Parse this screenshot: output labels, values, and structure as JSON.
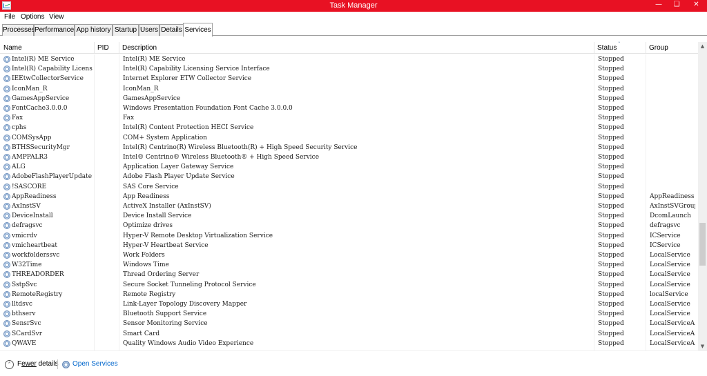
{
  "window": {
    "title": "Task Manager",
    "min_glyph": "—",
    "max_glyph": "❏",
    "close_glyph": "✕"
  },
  "menu": [
    "File",
    "Options",
    "View"
  ],
  "tabs": [
    "Processes",
    "Performance",
    "App history",
    "Startup",
    "Users",
    "Details",
    "Services"
  ],
  "active_tab": "Services",
  "columns": {
    "name": "Name",
    "pid": "PID",
    "description": "Description",
    "status": "Status",
    "group": "Group"
  },
  "sort_indicator": "˄",
  "rows": [
    {
      "name": "Intel(R) ME Service",
      "pid": "",
      "description": "Intel(R) ME Service",
      "status": "Stopped",
      "group": ""
    },
    {
      "name": "Intel(R) Capability Licensin...",
      "pid": "",
      "description": "Intel(R) Capability Licensing Service Interface",
      "status": "Stopped",
      "group": ""
    },
    {
      "name": "IEEtwCollectorService",
      "pid": "",
      "description": "Internet Explorer ETW Collector Service",
      "status": "Stopped",
      "group": ""
    },
    {
      "name": "IconMan_R",
      "pid": "",
      "description": "IconMan_R",
      "status": "Stopped",
      "group": ""
    },
    {
      "name": "GamesAppService",
      "pid": "",
      "description": "GamesAppService",
      "status": "Stopped",
      "group": ""
    },
    {
      "name": "FontCache3.0.0.0",
      "pid": "",
      "description": "Windows Presentation Foundation Font Cache 3.0.0.0",
      "status": "Stopped",
      "group": ""
    },
    {
      "name": "Fax",
      "pid": "",
      "description": "Fax",
      "status": "Stopped",
      "group": ""
    },
    {
      "name": "cphs",
      "pid": "",
      "description": "Intel(R) Content Protection HECI Service",
      "status": "Stopped",
      "group": ""
    },
    {
      "name": "COMSysApp",
      "pid": "",
      "description": "COM+ System Application",
      "status": "Stopped",
      "group": ""
    },
    {
      "name": "BTHSSecurityMgr",
      "pid": "",
      "description": "Intel(R) Centrino(R) Wireless Bluetooth(R) + High Speed Security Service",
      "status": "Stopped",
      "group": ""
    },
    {
      "name": "AMPPALR3",
      "pid": "",
      "description": "Intel® Centrino® Wireless Bluetooth® + High Speed Service",
      "status": "Stopped",
      "group": ""
    },
    {
      "name": "ALG",
      "pid": "",
      "description": "Application Layer Gateway Service",
      "status": "Stopped",
      "group": ""
    },
    {
      "name": "AdobeFlashPlayerUpdateSvc",
      "pid": "",
      "description": "Adobe Flash Player Update Service",
      "status": "Stopped",
      "group": ""
    },
    {
      "name": "!SASCORE",
      "pid": "",
      "description": "SAS Core Service",
      "status": "Stopped",
      "group": ""
    },
    {
      "name": "AppReadiness",
      "pid": "",
      "description": "App Readiness",
      "status": "Stopped",
      "group": "AppReadiness"
    },
    {
      "name": "AxInstSV",
      "pid": "",
      "description": "ActiveX Installer (AxInstSV)",
      "status": "Stopped",
      "group": "AxInstSVGroup"
    },
    {
      "name": "DeviceInstall",
      "pid": "",
      "description": "Device Install Service",
      "status": "Stopped",
      "group": "DcomLaunch"
    },
    {
      "name": "defragsvc",
      "pid": "",
      "description": "Optimize drives",
      "status": "Stopped",
      "group": "defragsvc"
    },
    {
      "name": "vmicrdv",
      "pid": "",
      "description": "Hyper-V Remote Desktop Virtualization Service",
      "status": "Stopped",
      "group": "ICService"
    },
    {
      "name": "vmicheartbeat",
      "pid": "",
      "description": "Hyper-V Heartbeat Service",
      "status": "Stopped",
      "group": "ICService"
    },
    {
      "name": "workfolderssvc",
      "pid": "",
      "description": "Work Folders",
      "status": "Stopped",
      "group": "LocalService"
    },
    {
      "name": "W32Time",
      "pid": "",
      "description": "Windows Time",
      "status": "Stopped",
      "group": "LocalService"
    },
    {
      "name": "THREADORDER",
      "pid": "",
      "description": "Thread Ordering Server",
      "status": "Stopped",
      "group": "LocalService"
    },
    {
      "name": "SstpSvc",
      "pid": "",
      "description": "Secure Socket Tunneling Protocol Service",
      "status": "Stopped",
      "group": "LocalService"
    },
    {
      "name": "RemoteRegistry",
      "pid": "",
      "description": "Remote Registry",
      "status": "Stopped",
      "group": "localService"
    },
    {
      "name": "lltdsvc",
      "pid": "",
      "description": "Link-Layer Topology Discovery Mapper",
      "status": "Stopped",
      "group": "LocalService"
    },
    {
      "name": "bthserv",
      "pid": "",
      "description": "Bluetooth Support Service",
      "status": "Stopped",
      "group": "LocalService"
    },
    {
      "name": "SensrSvc",
      "pid": "",
      "description": "Sensor Monitoring Service",
      "status": "Stopped",
      "group": "LocalServiceA..."
    },
    {
      "name": "SCardSvr",
      "pid": "",
      "description": "Smart Card",
      "status": "Stopped",
      "group": "LocalServiceA..."
    },
    {
      "name": "QWAVE",
      "pid": "",
      "description": "Quality Windows Audio Video Experience",
      "status": "Stopped",
      "group": "LocalServiceA..."
    }
  ],
  "scrollbar": {
    "up_glyph": "▲",
    "down_glyph": "▼"
  },
  "footer": {
    "fewer_details_prefix": "F",
    "fewer_details_underlined": "ewer",
    "fewer_details_suffix": " details",
    "fewer_details_glyph": "˄",
    "open_services": "Open Services"
  },
  "colors": {
    "titlebar": "#e81123",
    "link": "#0066cc"
  }
}
